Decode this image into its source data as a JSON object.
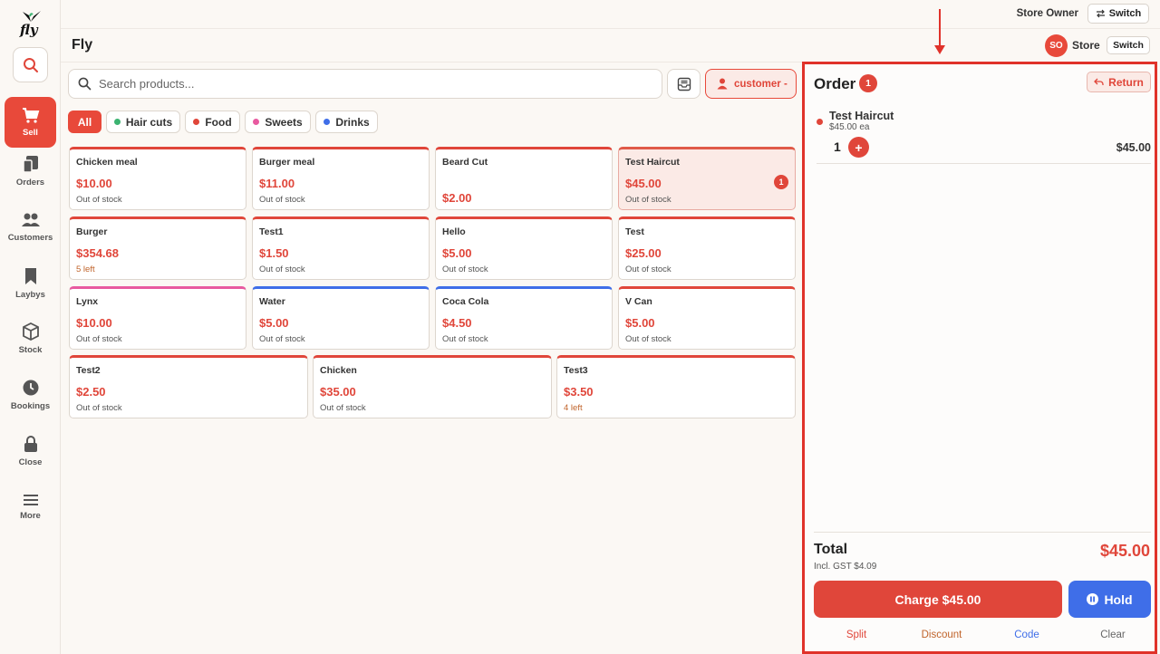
{
  "app": {
    "title": "Fly",
    "logo_text": "fly"
  },
  "topbar": {
    "owner": "Store Owner",
    "switch_label": "Switch",
    "avatar": "SO",
    "store": "Store",
    "store_switch_label": "Switch"
  },
  "sidebar": {
    "items": [
      {
        "label": "Sell",
        "icon": "cart-icon",
        "active": true
      },
      {
        "label": "Orders",
        "icon": "orders-icon"
      },
      {
        "label": "Customers",
        "icon": "customers-icon"
      },
      {
        "label": "Laybys",
        "icon": "bookmark-icon"
      },
      {
        "label": "Stock",
        "icon": "box-icon"
      },
      {
        "label": "Bookings",
        "icon": "clock-icon"
      },
      {
        "label": "Close",
        "icon": "lock-icon"
      },
      {
        "label": "More",
        "icon": "menu-icon"
      }
    ]
  },
  "search": {
    "placeholder": "Search products..."
  },
  "customer_button": {
    "label": "customer -"
  },
  "categories": [
    {
      "label": "All",
      "active": true
    },
    {
      "label": "Hair cuts",
      "color": "#3cb371"
    },
    {
      "label": "Food",
      "color": "#e0463a"
    },
    {
      "label": "Sweets",
      "color": "#e85aa0"
    },
    {
      "label": "Drinks",
      "color": "#3f6ee8"
    }
  ],
  "products": [
    {
      "name": "Chicken meal",
      "price": "$10.00",
      "stock": "Out of stock",
      "color": "#e0463a"
    },
    {
      "name": "Burger meal",
      "price": "$11.00",
      "stock": "Out of stock",
      "color": "#e0463a"
    },
    {
      "name": "Beard Cut",
      "price": "$2.00",
      "stock": "",
      "color": "#e0463a"
    },
    {
      "name": "Test Haircut",
      "price": "$45.00",
      "stock": "Out of stock",
      "color": "#e0463a",
      "qty": "1"
    },
    {
      "name": "Burger",
      "price": "$354.68",
      "stock": "5 left",
      "color": "#e0463a"
    },
    {
      "name": "Test1",
      "price": "$1.50",
      "stock": "Out of stock",
      "color": "#e0463a"
    },
    {
      "name": "Hello",
      "price": "$5.00",
      "stock": "Out of stock",
      "color": "#e0463a"
    },
    {
      "name": "Test",
      "price": "$25.00",
      "stock": "Out of stock",
      "color": "#e0463a"
    },
    {
      "name": "Lynx",
      "price": "$10.00",
      "stock": "Out of stock",
      "color": "#e85aa0"
    },
    {
      "name": "Water",
      "price": "$5.00",
      "stock": "Out of stock",
      "color": "#3f6ee8"
    },
    {
      "name": "Coca Cola",
      "price": "$4.50",
      "stock": "Out of stock",
      "color": "#3f6ee8"
    },
    {
      "name": "V Can",
      "price": "$5.00",
      "stock": "Out of stock",
      "color": "#e0463a"
    },
    {
      "name": "Test2",
      "price": "$2.50",
      "stock": "Out of stock",
      "color": "#e0463a"
    },
    {
      "name": "Chicken",
      "price": "$35.00",
      "stock": "Out of stock",
      "color": "#e0463a"
    },
    {
      "name": "Test3",
      "price": "$3.50",
      "stock": "4 left",
      "color": "#e0463a"
    }
  ],
  "order": {
    "title": "Order",
    "count": "1",
    "return_label": "Return",
    "items": [
      {
        "name": "Test Haircut",
        "each": "$45.00 ea",
        "qty": "1",
        "plus": "+",
        "total": "$45.00"
      }
    ],
    "total_label": "Total",
    "gst": "Incl. GST $4.09",
    "total": "$45.00",
    "charge_label": "Charge $45.00",
    "hold_label": "Hold",
    "links": {
      "split": "Split",
      "discount": "Discount",
      "code": "Code",
      "clear": "Clear"
    }
  },
  "colors": {
    "accent": "#e0463a",
    "blue": "#3f6ee8",
    "highlight": "#e0322a"
  }
}
